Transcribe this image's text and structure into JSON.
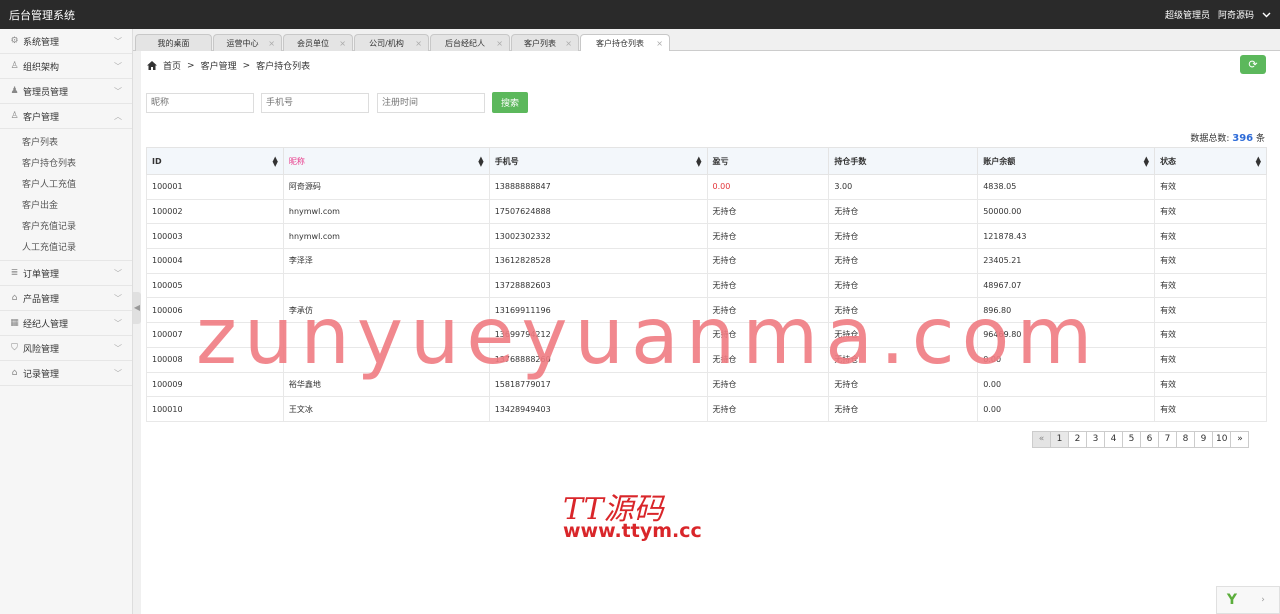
{
  "app": {
    "title": "后台管理系统",
    "role": "超级管理员",
    "username": "阿奇源码"
  },
  "sidebar": {
    "items": [
      {
        "label": "系统管理",
        "icon": "gear-icon",
        "glyph": "⚙",
        "expanded": false
      },
      {
        "label": "组织架构",
        "icon": "user-icon",
        "glyph": "♙",
        "expanded": false
      },
      {
        "label": "管理员管理",
        "icon": "person-icon",
        "glyph": "♟",
        "expanded": false
      },
      {
        "label": "客户管理",
        "icon": "user-icon",
        "glyph": "♙",
        "expanded": true,
        "children": [
          "客户列表",
          "客户持仓列表",
          "客户人工充值",
          "客户出金",
          "客户充值记录",
          "人工充值记录"
        ]
      },
      {
        "label": "订单管理",
        "icon": "list-icon",
        "glyph": "≣",
        "expanded": false
      },
      {
        "label": "产品管理",
        "icon": "briefcase-icon",
        "glyph": "⌂",
        "expanded": false
      },
      {
        "label": "经纪人管理",
        "icon": "grid-icon",
        "glyph": "▦",
        "expanded": false
      },
      {
        "label": "风险管理",
        "icon": "shield-icon",
        "glyph": "⛉",
        "expanded": false
      },
      {
        "label": "记录管理",
        "icon": "lock-icon",
        "glyph": "⌂",
        "expanded": false
      }
    ]
  },
  "tabs": [
    {
      "label": "我的桌面",
      "closable": false,
      "active": false
    },
    {
      "label": "运营中心",
      "closable": true,
      "active": false
    },
    {
      "label": "会员单位",
      "closable": true,
      "active": false
    },
    {
      "label": "公司/机构",
      "closable": true,
      "active": false
    },
    {
      "label": "后台经纪人",
      "closable": true,
      "active": false
    },
    {
      "label": "客户列表",
      "closable": true,
      "active": false
    },
    {
      "label": "客户持仓列表",
      "closable": true,
      "active": true
    }
  ],
  "breadcrumb": {
    "home": "首页",
    "sep": ">",
    "level1": "客户管理",
    "level2": "客户持仓列表"
  },
  "filters": {
    "nickname_placeholder": "昵称",
    "phone_placeholder": "手机号",
    "regtime_placeholder": "注册时间",
    "search_label": "搜索"
  },
  "summary": {
    "label": "数据总数:",
    "count": "396",
    "unit": "条"
  },
  "colors": {
    "accent_green": "#5cb85c",
    "loss_red": "#e2353a",
    "topbar": "#2a2a2a",
    "count_blue": "#2d6bd8"
  },
  "table": {
    "columns": [
      "ID",
      "昵称",
      "手机号",
      "盈亏",
      "持仓手数",
      "账户余额",
      "状态"
    ],
    "rows": [
      [
        "100001",
        "阿奇源码",
        "13888888847",
        "0.00",
        "3.00",
        "4838.05",
        "有效"
      ],
      [
        "100002",
        "hnymwl.com",
        "17507624888",
        "无持仓",
        "无持仓",
        "50000.00",
        "有效"
      ],
      [
        "100003",
        "hnymwl.com",
        "13002302332",
        "无持仓",
        "无持仓",
        "121878.43",
        "有效"
      ],
      [
        "100004",
        "李泽泽",
        "13612828528",
        "无持仓",
        "无持仓",
        "23405.21",
        "有效"
      ],
      [
        "100005",
        "",
        "13728882603",
        "无持仓",
        "无持仓",
        "48967.07",
        "有效"
      ],
      [
        "100006",
        "李承仿",
        "13169911196",
        "无持仓",
        "无持仓",
        "896.80",
        "有效"
      ],
      [
        "100007",
        "",
        "13699794212",
        "无持仓",
        "无持仓",
        "96469.80",
        "有效"
      ],
      [
        "100008",
        "",
        "13768888260",
        "无持仓",
        "无持仓",
        "0.00",
        "有效"
      ],
      [
        "100009",
        "裕华鑫地",
        "15818779017",
        "无持仓",
        "无持仓",
        "0.00",
        "有效"
      ],
      [
        "100010",
        "王文冰",
        "13428949403",
        "无持仓",
        "无持仓",
        "0.00",
        "有效"
      ]
    ]
  },
  "pagination": {
    "prev": "«",
    "next": "»",
    "pages": [
      "1",
      "2",
      "3",
      "4",
      "5",
      "6",
      "7",
      "8",
      "9",
      "10"
    ],
    "current": "1"
  },
  "watermark": {
    "text": "zunyueyuanma.com",
    "logo_top": "TT源码",
    "logo_bottom": "www.ttym.cc"
  }
}
